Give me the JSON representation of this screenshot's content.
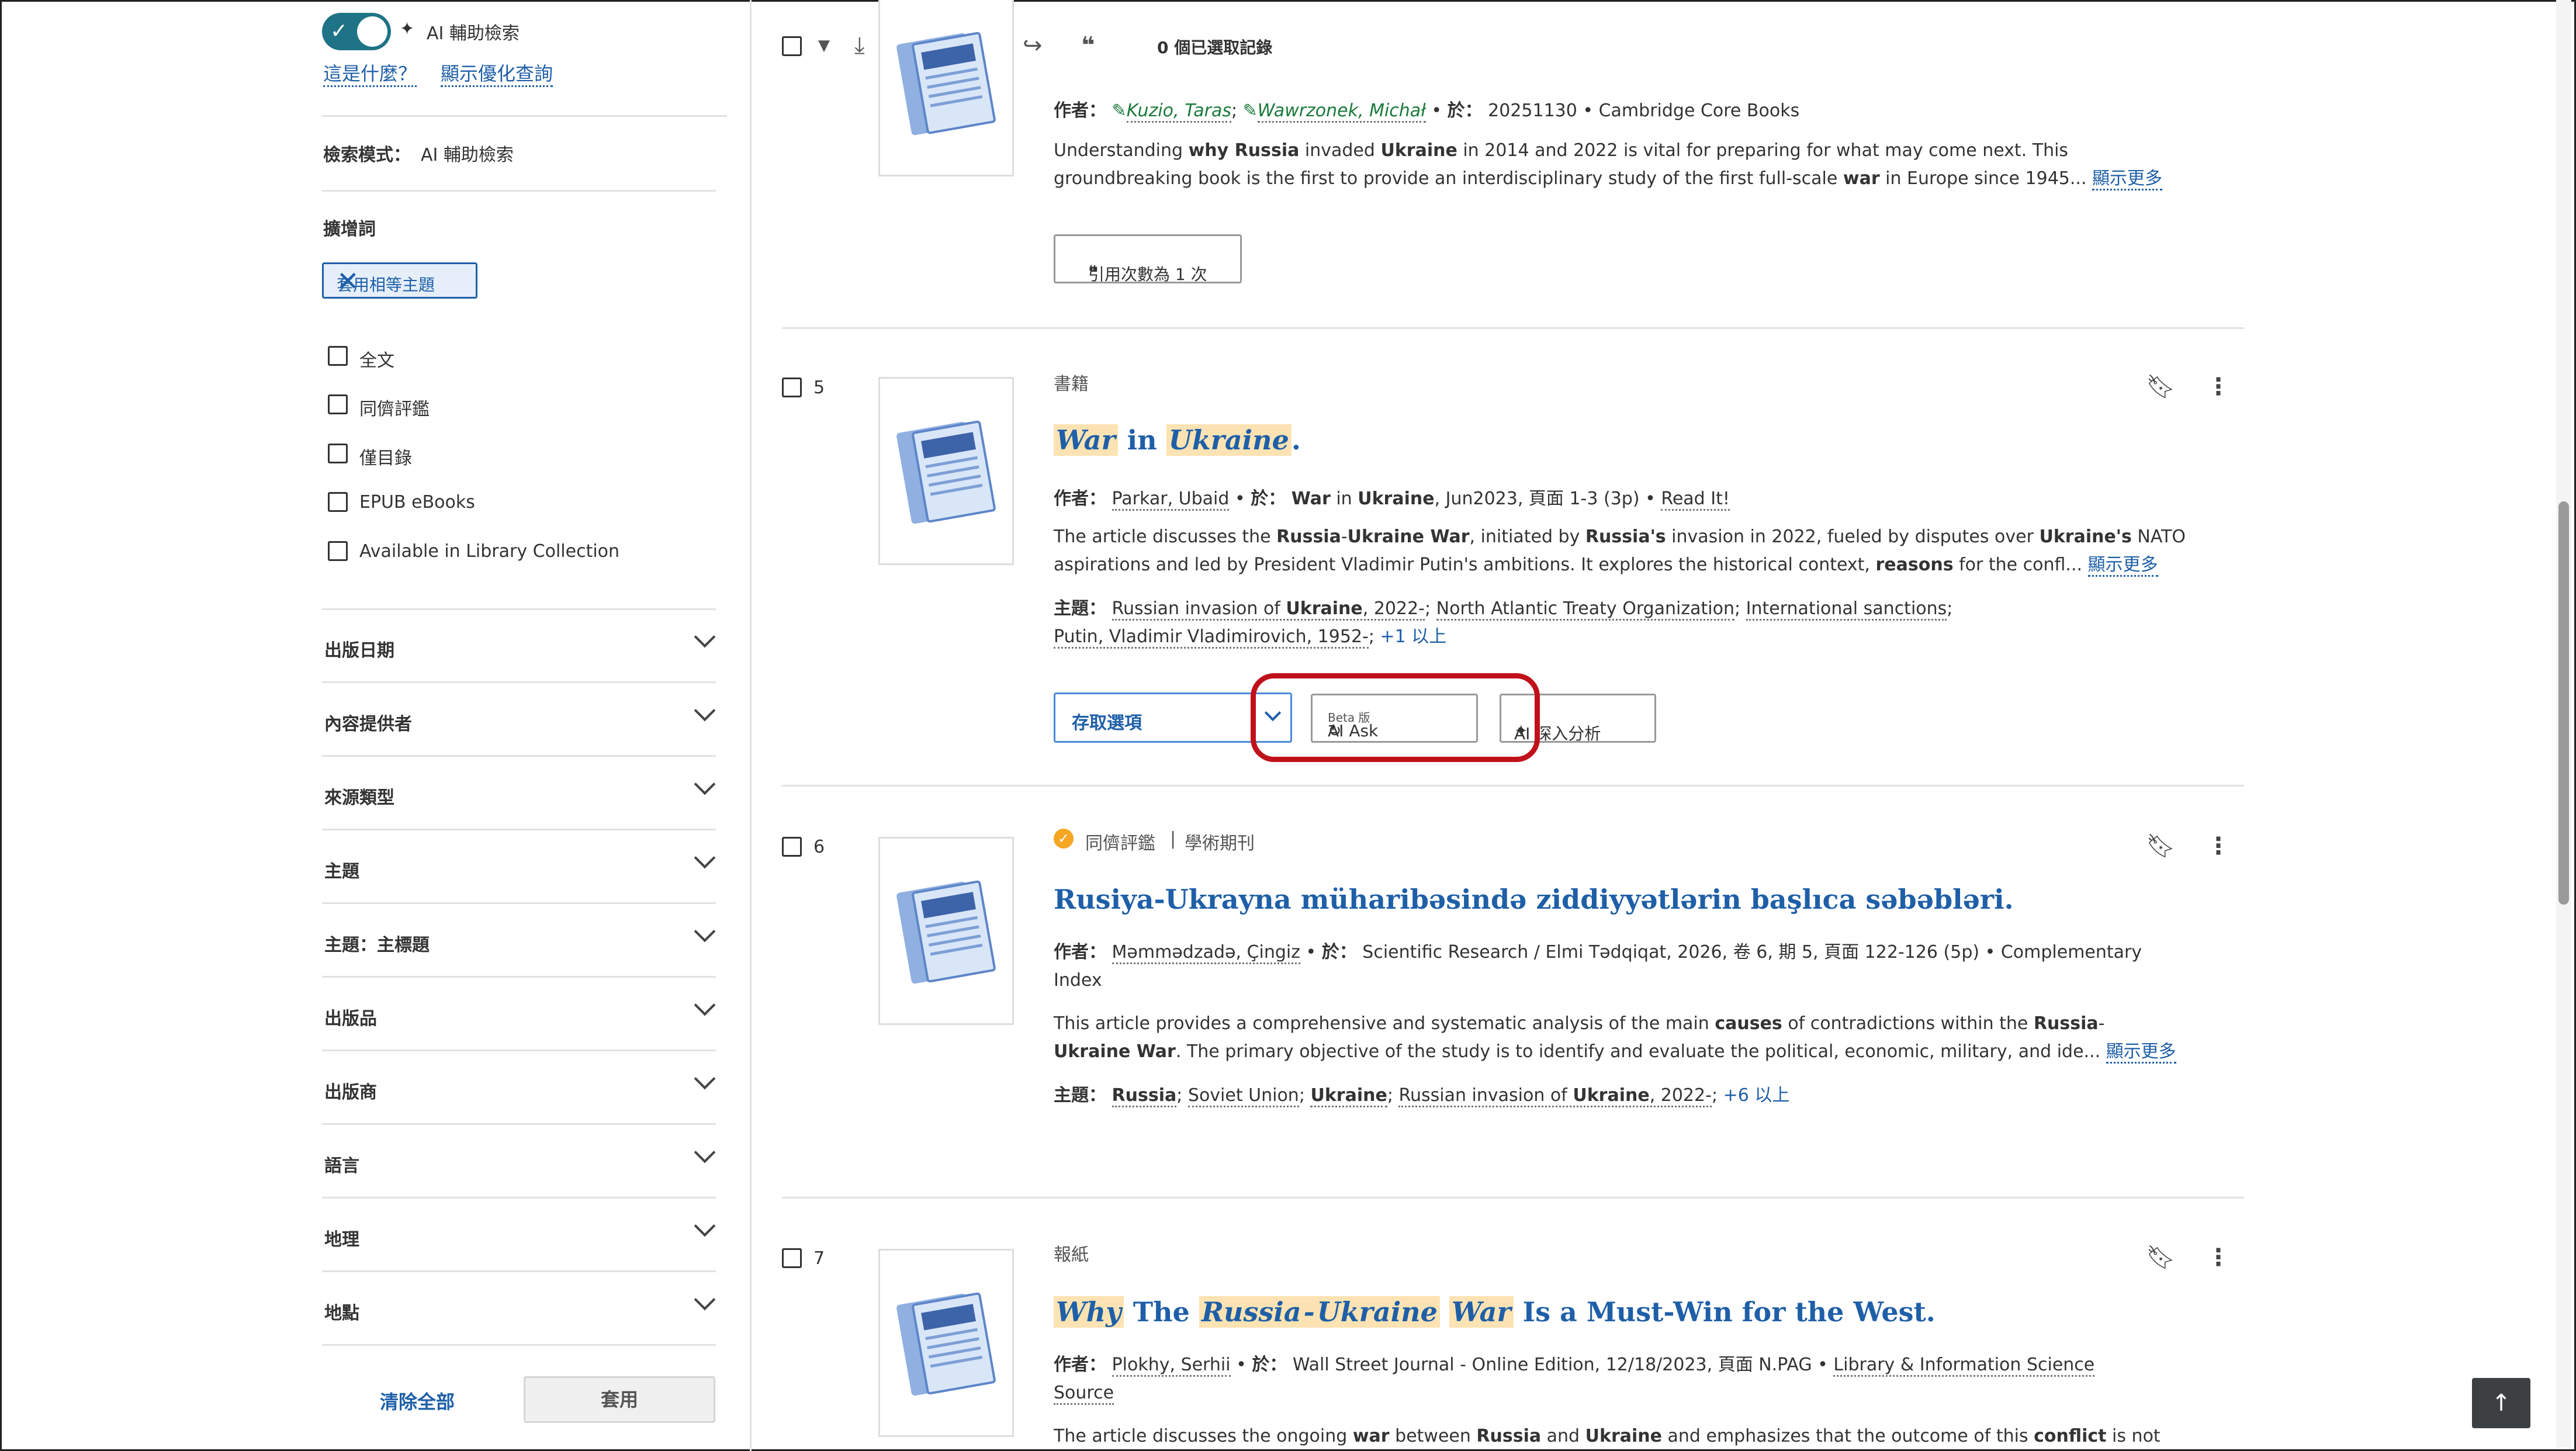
{
  "sidebar": {
    "ai_label": "AI 輔助檢索",
    "what_is_this": "這是什麼？",
    "show_optimized": "顯示優化查詢",
    "search_mode_label": "檢索模式：",
    "search_mode_value": "AI 輔助檢索",
    "expanders_heading": "擴增詞",
    "chip_label": "套用相等主題",
    "filters": [
      "全文",
      "同儕評鑑",
      "僅目錄",
      "EPUB eBooks",
      "Available in Library Collection"
    ],
    "facets": [
      "出版日期",
      "內容提供者",
      "來源類型",
      "主題",
      "主題：主標題",
      "出版品",
      "出版商",
      "語言",
      "地理",
      "地點"
    ],
    "clear_all": "清除全部",
    "apply": "套用"
  },
  "toolbar": {
    "selected_count": "0 個已選取記錄"
  },
  "result4": {
    "author_label": "作者：",
    "author1": "Kuzio, Taras",
    "author2": "Wawrzonek, Michał",
    "in_label": "於：",
    "source": "20251130 • Cambridge Core Books",
    "abstract_line1_a": "Understanding ",
    "abstract_line1_b": "why Russia",
    "abstract_line1_c": " invaded ",
    "abstract_line1_d": "Ukraine",
    "abstract_line1_e": " in 2014 and 2022 is vital for preparing for what may come next. This",
    "abstract_line2_a": "groundbreaking book is the first to provide an interdisciplinary study of the first full-scale ",
    "abstract_line2_b": "war",
    "abstract_line2_c": " in Europe since 1945...",
    "show_more": "顯示更多",
    "cite_button": "引用次數為 1 次"
  },
  "result5": {
    "number": "5",
    "type": "書籍",
    "title_a": "War",
    "title_b": " in ",
    "title_c": "Ukraine",
    "title_d": ".",
    "author_label": "作者：",
    "author": "Parkar, Ubaid",
    "in_label": "於：",
    "source_a": "War",
    "source_b": " in ",
    "source_c": "Ukraine",
    "source_d": ", Jun2023, 頁面 1-3 (3p) •",
    "read_it": "Read It!",
    "abstract_line1_a": "The article discusses the ",
    "abstract_line1_b": "Russia",
    "abstract_line1_c": "-",
    "abstract_line1_d": "Ukraine War",
    "abstract_line1_e": ", initiated by ",
    "abstract_line1_f": "Russia's",
    "abstract_line1_g": " invasion in 2022, fueled by disputes over ",
    "abstract_line1_h": "Ukraine's",
    "abstract_line1_i": " NATO",
    "abstract_line2_a": "aspirations and led by President Vladimir Putin's ambitions. It explores the historical context, ",
    "abstract_line2_b": "reasons",
    "abstract_line2_c": " for the confl...",
    "show_more": "顯示更多",
    "subjects_label": "主題：",
    "subject1_a": "Russian invasion of ",
    "subject1_b": "Ukraine",
    "subject1_c": ", 2022-",
    "subject2": "North Atlantic Treaty Organization",
    "subject3": "International sanctions",
    "subject4": "Putin, Vladimir Vladimirovich, 1952-",
    "subjects_more": "+1 以上",
    "access_options": "存取選項",
    "ai_ask": "AI Ask",
    "ai_ask_beta": "Beta 版",
    "ai_insights": "AI 深入分析"
  },
  "result6": {
    "number": "6",
    "peer_reviewed": "同儕評鑑",
    "divider": "|",
    "type": "學術期刊",
    "title": "Rusiya-Ukrayna müharibəsində ziddiyyətlərin başlıca səbəbləri.",
    "author_label": "作者：",
    "author": "Məmmədzadə, Çingiz",
    "in_label": "於：",
    "source": "Scientific Research / Elmi Tədqiqat, 2026, 卷 6, 期 5, 頁面 122-126 (5p) • Complementary",
    "source_line2": "Index",
    "abstract_line1_a": "This article provides a comprehensive and systematic analysis of the main ",
    "abstract_line1_b": "causes",
    "abstract_line1_c": " of contradictions within the ",
    "abstract_line1_d": "Russia",
    "abstract_line1_e": "-",
    "abstract_line2_a": "Ukraine War",
    "abstract_line2_b": ". The primary objective of the study is to identify and evaluate the political, economic, military, and ide...",
    "show_more": "顯示更多",
    "subjects_label": "主題：",
    "subject1": "Russia",
    "subject2": "Soviet Union",
    "subject3": "Ukraine",
    "subject4_a": "Russian invasion of ",
    "subject4_b": "Ukraine",
    "subject4_c": ", 2022-",
    "subjects_more": "+6 以上"
  },
  "result7": {
    "number": "7",
    "type": "報紙",
    "title_a": "Why",
    "title_b": " The ",
    "title_c": "Russia",
    "title_d": "-",
    "title_e": "Ukraine",
    "title_f": " ",
    "title_g": "War",
    "title_h": " Is a Must-Win for the West.",
    "author_label": "作者：",
    "author": "Plokhy, Serhii",
    "in_label": "於：",
    "source": "Wall Street Journal - Online Edition, 12/18/2023, 頁面 N.PAG •",
    "link1": "Library & Information Science",
    "link2": "Source",
    "abstract_a": "The article discusses the ongoing ",
    "abstract_b": "war",
    "abstract_c": " between ",
    "abstract_d": "Russia",
    "abstract_e": " and ",
    "abstract_f": "Ukraine",
    "abstract_g": " and emphasizes that the outcome of this ",
    "abstract_h": "conflict",
    "abstract_i": " is not"
  },
  "colors": {
    "accent": "#1e5fa8",
    "toggle": "#1e7386",
    "highlight": "#fde3b3",
    "annotation_red": "#c0111b"
  }
}
